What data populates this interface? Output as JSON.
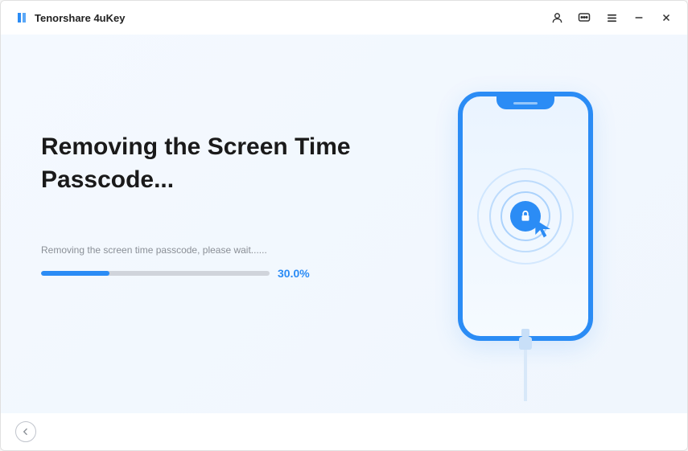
{
  "app": {
    "title": "Tenorshare 4uKey"
  },
  "main": {
    "heading": "Removing the Screen Time Passcode...",
    "status": "Removing the screen time passcode, please wait......",
    "progress_percent": 30.0,
    "progress_label": "30.0%"
  },
  "colors": {
    "accent": "#2b8cf5"
  },
  "icons": {
    "account": "account-icon",
    "feedback": "feedback-icon",
    "menu": "menu-icon",
    "minimize": "minimize-icon",
    "close": "close-icon",
    "lock": "lock-icon",
    "back": "back-arrow-icon"
  }
}
